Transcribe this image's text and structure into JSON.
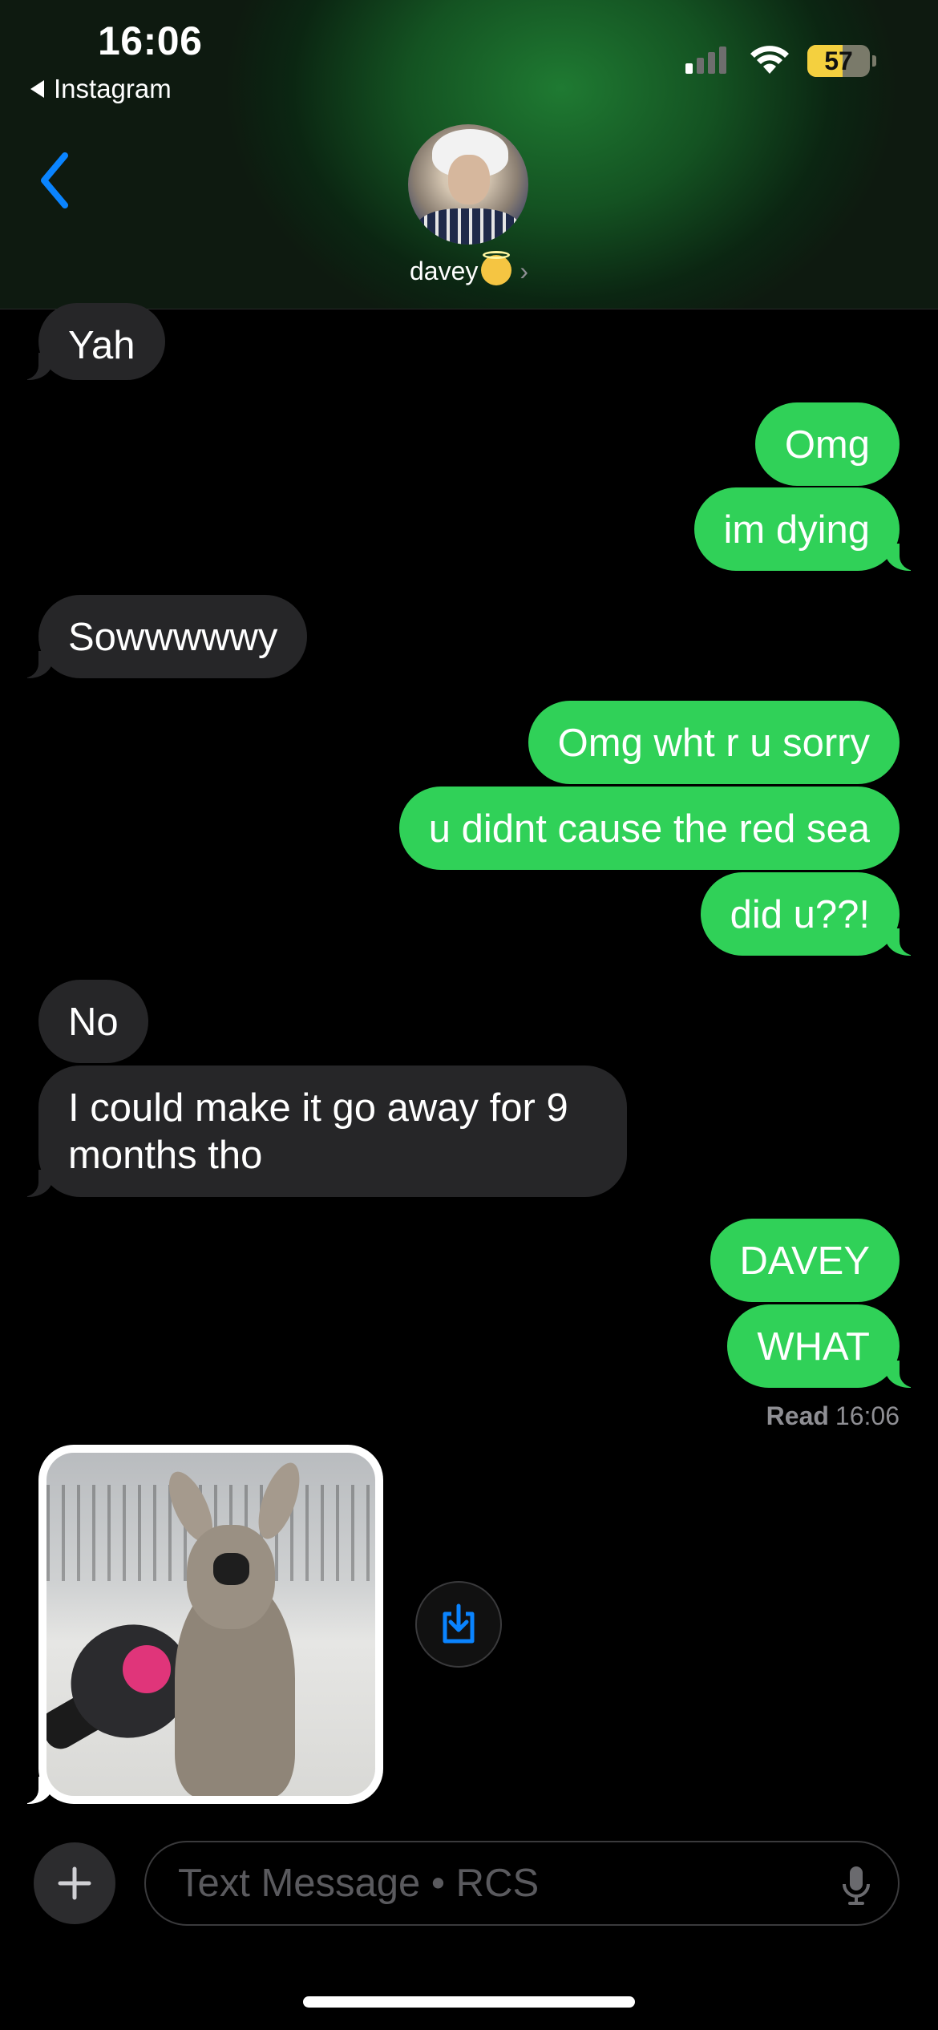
{
  "status_bar": {
    "time": "16:06",
    "back_app": "Instagram",
    "battery": "57",
    "battery_level": 0.57,
    "signal_bars_active": 1,
    "signal_bars_total": 4
  },
  "header": {
    "contact_name": "davey",
    "contact_emoji": "smiling-face-with-halo",
    "back_icon": "chevron-left-icon",
    "accent_color": "#0a84ff"
  },
  "messages": [
    {
      "direction": "incoming",
      "text": "Yah"
    },
    {
      "direction": "outgoing",
      "text": "Omg"
    },
    {
      "direction": "outgoing",
      "text": "im dying"
    },
    {
      "direction": "incoming",
      "text": "Sowwwwwy"
    },
    {
      "direction": "outgoing",
      "text": "Omg wht r u sorry"
    },
    {
      "direction": "outgoing",
      "text": "u didnt cause the red sea"
    },
    {
      "direction": "outgoing",
      "text": "did u??!"
    },
    {
      "direction": "incoming",
      "text": "No"
    },
    {
      "direction": "incoming",
      "text": "I could make it go away for 9 months tho"
    },
    {
      "direction": "outgoing",
      "text": "DAVEY"
    },
    {
      "direction": "outgoing",
      "text": "WHAT"
    }
  ],
  "read_receipt": {
    "label": "Read",
    "time": "16:06"
  },
  "image_message": {
    "direction": "incoming",
    "image_content": "deer-with-microphone-meme",
    "save_icon": "save-download-icon"
  },
  "composer": {
    "placeholder": "Text Message • RCS",
    "plus_icon": "plus-icon",
    "mic_icon": "microphone-icon"
  },
  "colors": {
    "outgoing_bubble": "#30d158",
    "incoming_bubble": "#262628",
    "background": "#000000"
  }
}
